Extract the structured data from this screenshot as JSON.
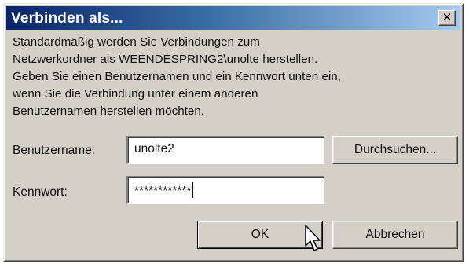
{
  "dialog": {
    "title": "Verbinden als...",
    "message_lines": [
      "Standardmäßig werden Sie Verbindungen zum",
      "Netzwerkordner als WEENDESPRING2\\unolte herstellen.",
      "Geben Sie einen Benutzernamen und ein Kennwort unten ein,",
      "wenn Sie die Verbindung unter einem anderen",
      "Benutzernamen herstellen möchten."
    ],
    "username_label": "Benutzername:",
    "username_value": "unolte2",
    "browse_button": "Durchsuchen...",
    "password_label": "Kennwort:",
    "password_value": "************",
    "ok_button": "OK",
    "cancel_button": "Abbrechen"
  },
  "icons": {
    "close": "close-icon",
    "cursor": "mouse-pointer-icon"
  },
  "colors": {
    "title_gradient_start": "#0a246a",
    "title_gradient_end": "#a6caf0",
    "face": "#d4d0c8"
  }
}
